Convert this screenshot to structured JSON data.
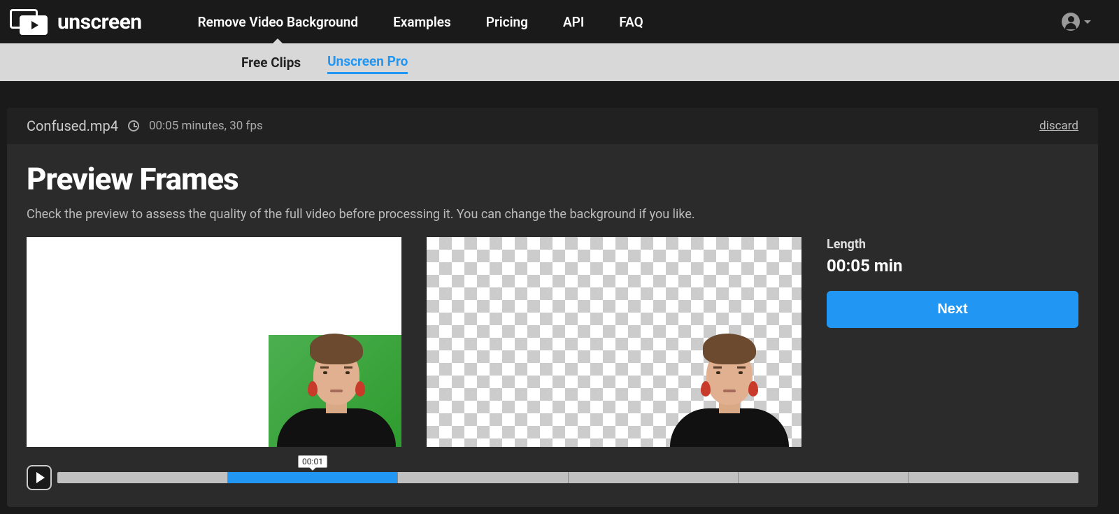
{
  "brand": "unscreen",
  "nav": {
    "items": [
      {
        "label": "Remove Video Background",
        "active": true
      },
      {
        "label": "Examples",
        "active": false
      },
      {
        "label": "Pricing",
        "active": false
      },
      {
        "label": "API",
        "active": false
      },
      {
        "label": "FAQ",
        "active": false
      }
    ]
  },
  "subnav": {
    "items": [
      {
        "label": "Free Clips",
        "active": false
      },
      {
        "label": "Unscreen Pro",
        "active": true
      }
    ]
  },
  "file": {
    "name": "Confused.mp4",
    "meta": "00:05 minutes, 30 fps"
  },
  "actions": {
    "discard": "discard"
  },
  "page": {
    "title": "Preview Frames",
    "description": "Check the preview to assess the quality of the full video before processing it. You can change the background if you like."
  },
  "side": {
    "length_label": "Length",
    "length_value": "00:05 min",
    "next_label": "Next"
  },
  "timeline": {
    "tooltip": "00:01",
    "segments": 6,
    "active_index": 1
  }
}
